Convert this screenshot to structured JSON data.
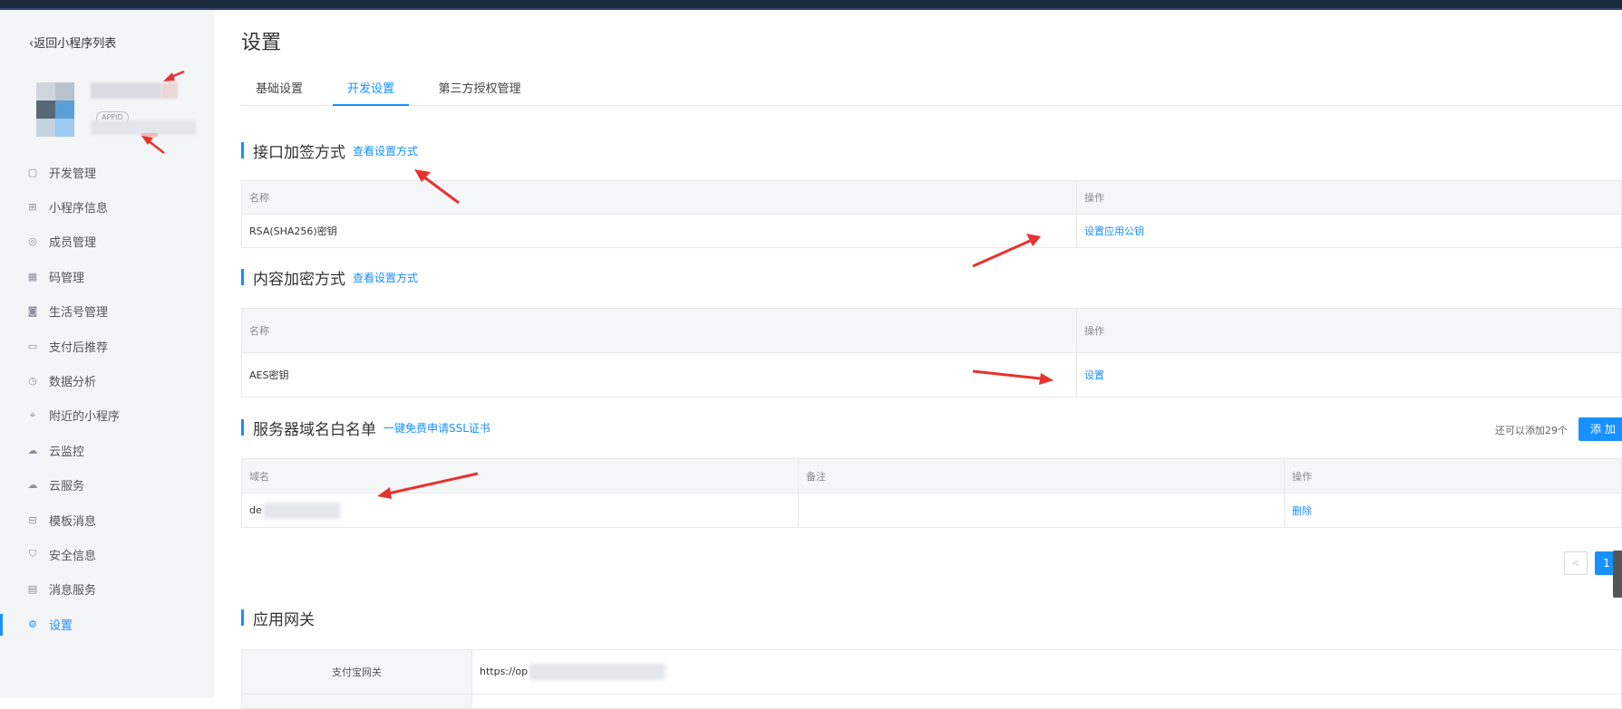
{
  "sidebar": {
    "back_label": "返回小程序列表",
    "appid_badge": "APPID",
    "items": [
      {
        "label": "开发管理",
        "icon": "code-box-icon"
      },
      {
        "label": "小程序信息",
        "icon": "grid-icon"
      },
      {
        "label": "成员管理",
        "icon": "user-circle-icon"
      },
      {
        "label": "码管理",
        "icon": "qr-code-icon"
      },
      {
        "label": "生活号管理",
        "icon": "profile-card-icon"
      },
      {
        "label": "支付后推荐",
        "icon": "laptop-icon"
      },
      {
        "label": "数据分析",
        "icon": "clock-chart-icon"
      },
      {
        "label": "附近的小程序",
        "icon": "location-icon"
      },
      {
        "label": "云监控",
        "icon": "cloud-icon"
      },
      {
        "label": "云服务",
        "icon": "cloud-icon"
      },
      {
        "label": "模板消息",
        "icon": "message-box-icon"
      },
      {
        "label": "安全信息",
        "icon": "shield-icon"
      },
      {
        "label": "消息服务",
        "icon": "monitor-icon"
      },
      {
        "label": "设置",
        "icon": "gear-icon",
        "active": true
      }
    ]
  },
  "main": {
    "title": "设置",
    "tabs": [
      {
        "label": "基础设置",
        "active": false
      },
      {
        "label": "开发设置",
        "active": true
      },
      {
        "label": "第三方授权管理",
        "active": false
      }
    ],
    "sign_section": {
      "title": "接口加签方式",
      "link": "查看设置方式",
      "col_name": "名称",
      "col_op": "操作",
      "row_name": "RSA(SHA256)密钥",
      "row_op": "设置应用公钥"
    },
    "encrypt_section": {
      "title": "内容加密方式",
      "link": "查看设置方式",
      "col_name": "名称",
      "col_op": "操作",
      "row_name": "AES密钥",
      "row_op": "设置"
    },
    "domain_section": {
      "title": "服务器域名白名单",
      "link": "一键免费申请SSL证书",
      "remaining": "还可以添加29个",
      "add_label": "添 加",
      "col_domain": "域名",
      "col_note": "备注",
      "col_op": "操作",
      "row_domain": "de",
      "row_note": "",
      "row_op": "删除",
      "pager_prev": "<",
      "pager_current": "1"
    },
    "gateway_section": {
      "title": "应用网关",
      "row_label": "支付宝网关",
      "row_value": "https://op"
    }
  },
  "colors": {
    "accent": "#1890ff",
    "sidebar_bg": "#f4f5f7",
    "annotation_arrow": "#e8322e"
  }
}
